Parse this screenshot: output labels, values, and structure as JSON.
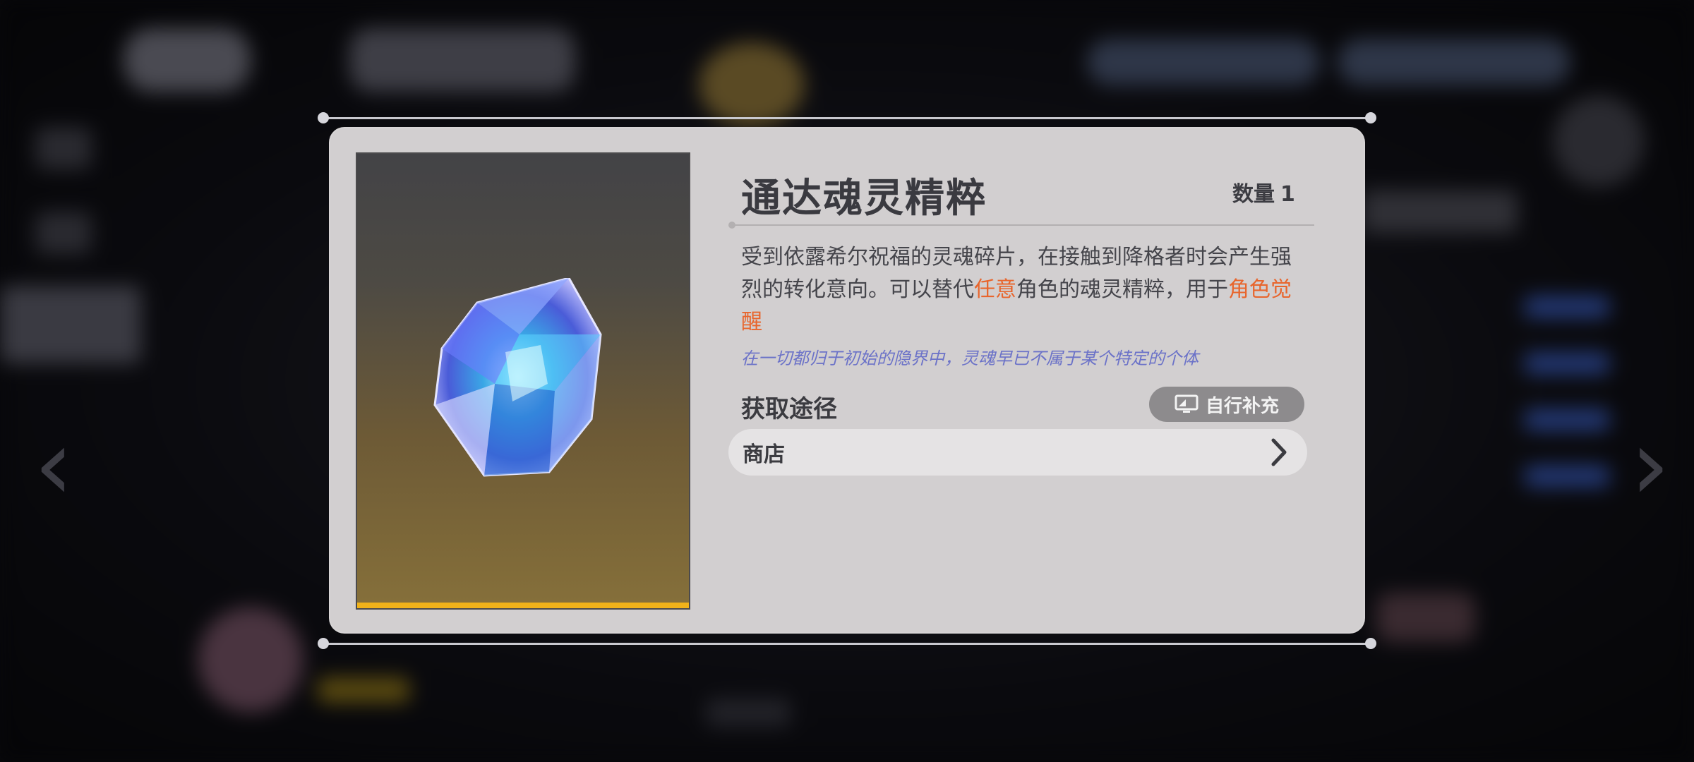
{
  "item": {
    "name": "通达魂灵精粹",
    "quantity_label": "数量",
    "quantity_value": "1",
    "description_parts": [
      {
        "text": "受到依露希尔祝福的灵魂碎片，在接触到降格者时会产生强烈的转化意向。可以替代",
        "highlight": false
      },
      {
        "text": "任意",
        "highlight": true
      },
      {
        "text": "角色的魂灵精粹，用于",
        "highlight": false
      },
      {
        "text": "角色觉醒",
        "highlight": true
      }
    ],
    "flavor_text": "在一切都归于初始的隐界中，灵魂早已不属于某个特定的个体",
    "rarity_color": "#f0b21a",
    "icon": "soul-crystal-icon"
  },
  "sources": {
    "title": "获取途径",
    "replenish_button": {
      "label": "自行补充",
      "icon": "monitor-icon"
    },
    "items": [
      {
        "label": "商店",
        "icon": "chevron-right-icon"
      }
    ]
  },
  "colors": {
    "highlight": "#e8652c",
    "flavor": "#6b72c8",
    "panel": "#d2cfd0"
  }
}
